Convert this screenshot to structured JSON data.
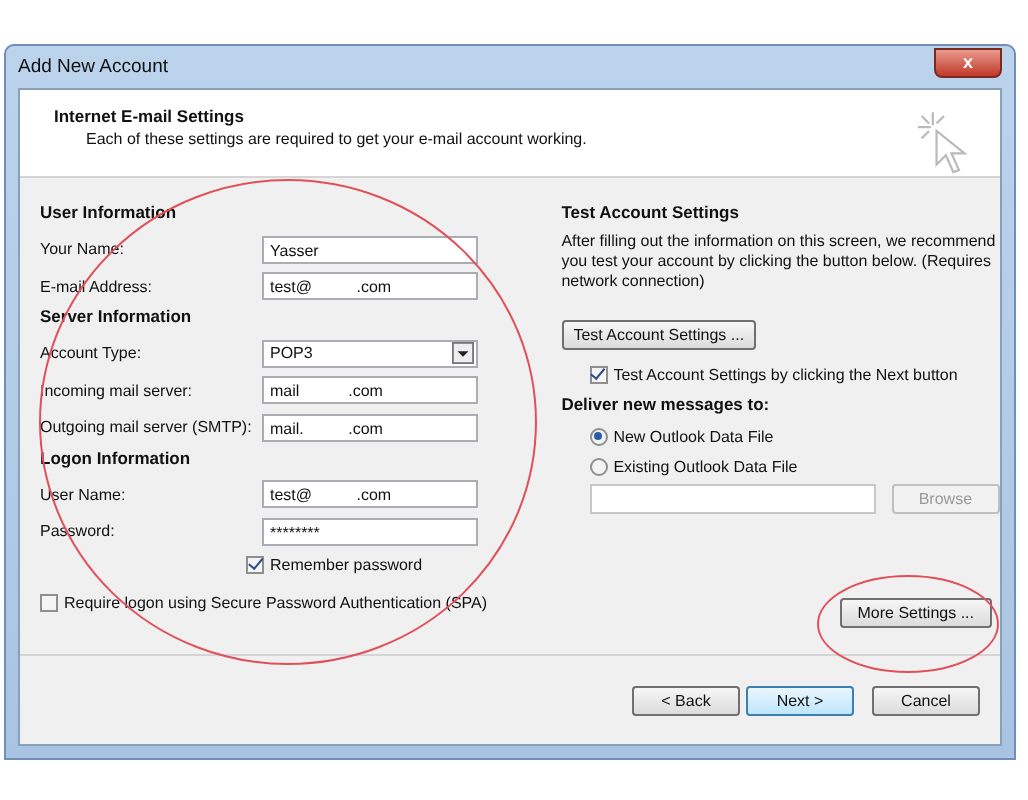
{
  "window": {
    "title": "Add New Account",
    "close": "x"
  },
  "header": {
    "title": "Internet E-mail Settings",
    "subtitle": "Each of these settings are required to get your e-mail account working."
  },
  "left": {
    "sections": [
      {
        "heading": "User Information",
        "fields": [
          {
            "label": "Your Name:",
            "value": "Yasser",
            "kind": "text"
          },
          {
            "label": "E-mail Address:",
            "value": "test@          .com",
            "kind": "text"
          }
        ]
      },
      {
        "heading": "Server Information",
        "fields": [
          {
            "label": "Account Type:",
            "value": "POP3",
            "kind": "select"
          },
          {
            "label": "Incoming mail server:",
            "value": "mail           .com",
            "kind": "text"
          },
          {
            "label": "Outgoing mail server (SMTP):",
            "value": "mail.          .com",
            "kind": "text"
          }
        ]
      },
      {
        "heading": "Logon Information",
        "fields": [
          {
            "label": "User Name:",
            "value": "test@          .com",
            "kind": "text"
          },
          {
            "label": "Password:",
            "value": "********",
            "kind": "text"
          }
        ]
      }
    ],
    "remember": {
      "label": "Remember password",
      "checked": true
    },
    "spa": {
      "label": "Require logon using Secure Password Authentication (SPA)",
      "checked": false
    }
  },
  "right": {
    "heading": "Test Account Settings",
    "text": "After filling out the information on this screen, we recommend you test your account by clicking the button below. (Requires network connection)",
    "test_button": "Test Account Settings ...",
    "test_next": {
      "label": "Test Account Settings by clicking the Next button",
      "checked": true
    },
    "deliver_heading": "Deliver new messages to:",
    "options": [
      {
        "label": "New Outlook Data File",
        "selected": true
      },
      {
        "label": "Existing Outlook Data File",
        "selected": false
      }
    ],
    "browse": {
      "label": "Browse",
      "disabled": true
    },
    "more_settings": "More Settings ..."
  },
  "footer": {
    "buttons": [
      {
        "label": "< Back",
        "default": false
      },
      {
        "label": "Next >",
        "default": true
      },
      {
        "label": "Cancel",
        "default": false
      }
    ]
  }
}
